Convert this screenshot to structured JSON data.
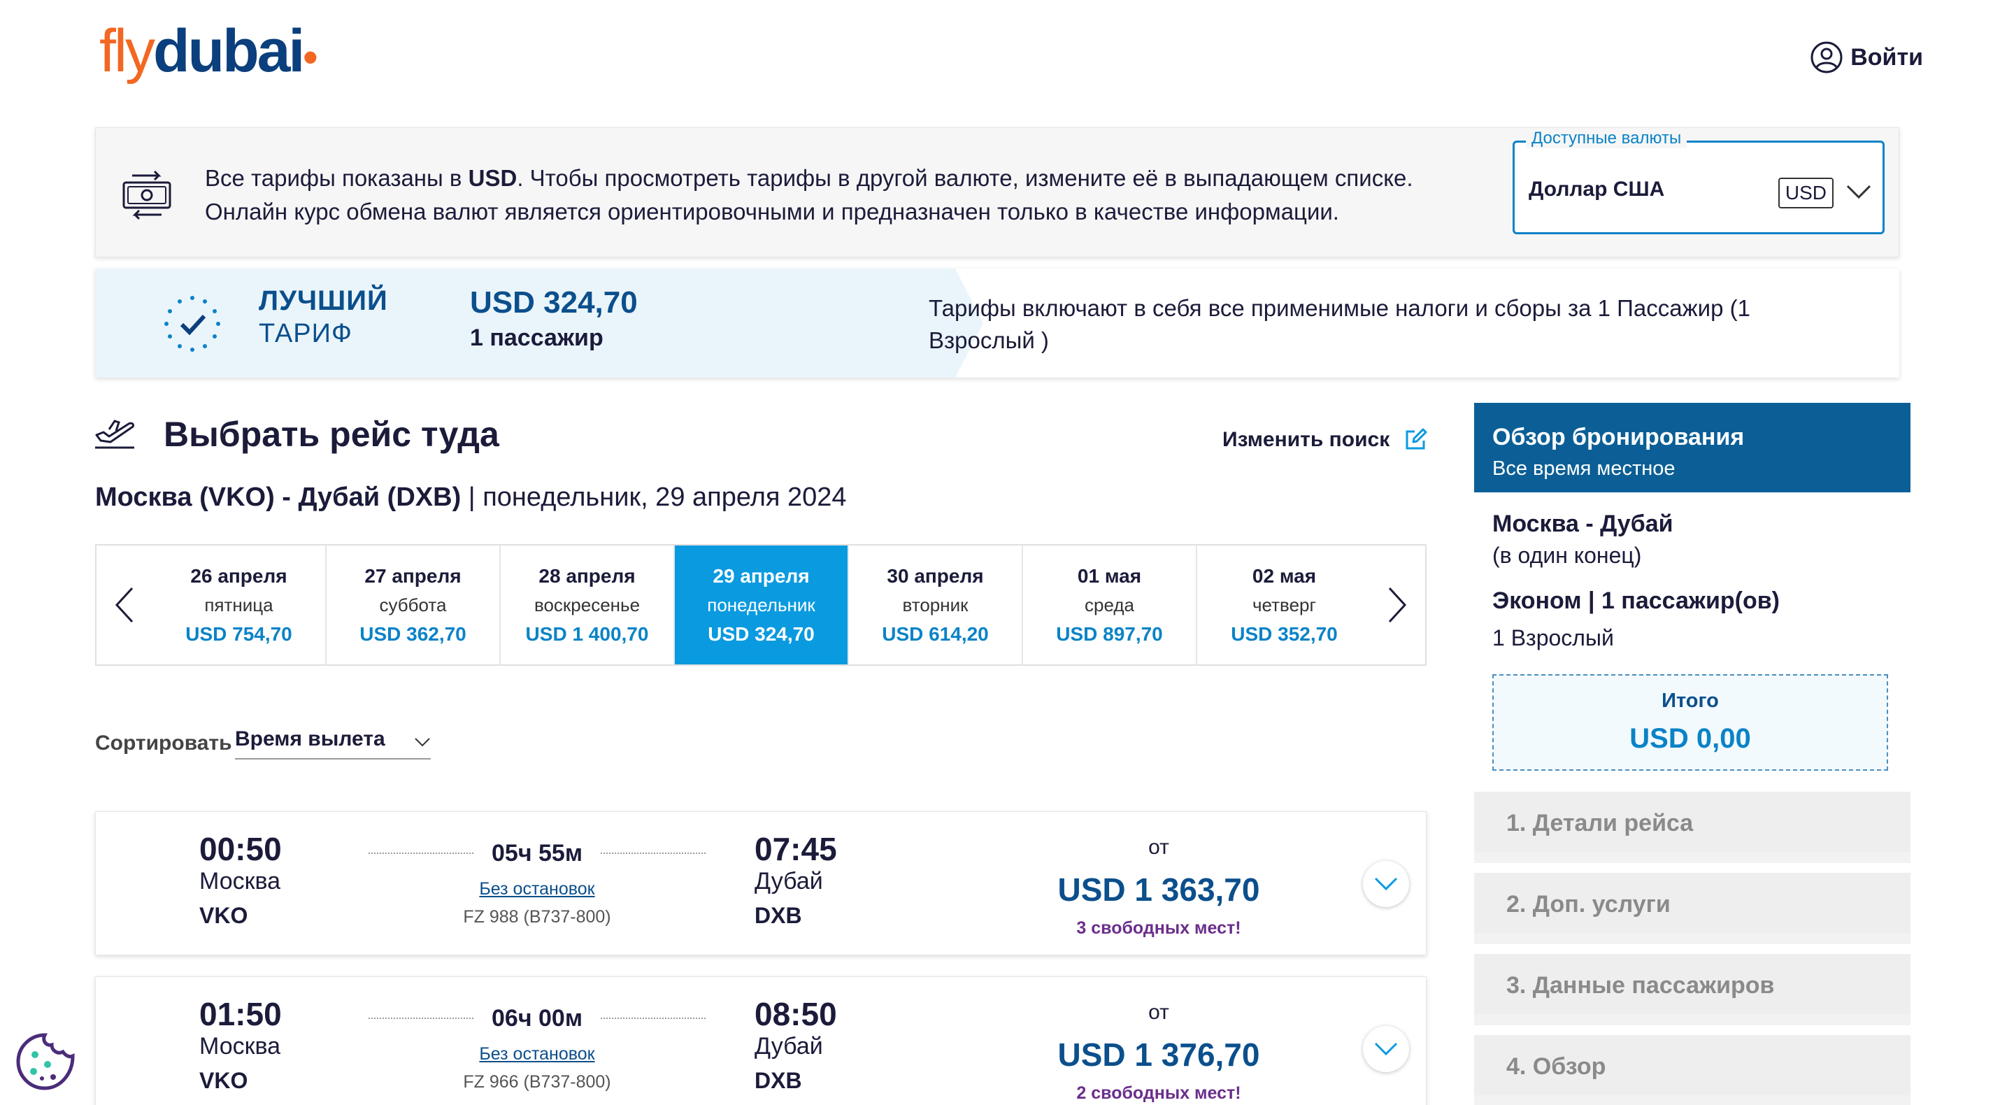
{
  "header": {
    "logo_fly": "fly",
    "logo_dubai": "dubai",
    "login_label": "Войти",
    "login_icon": "user-circle-icon"
  },
  "currency": {
    "notice_line1_prefix": "Все тарифы показаны в ",
    "notice_line1_code": "USD",
    "notice_line1_suffix": ". Чтобы просмотреть тарифы в другой валюте, измените её в выпадающем списке.",
    "notice_line2": "Онлайн курс обмена валют является ориентировочными и предназначен только в качестве информации.",
    "select_legend": "Доступные валюты",
    "select_value": "Доллар США",
    "select_code": "USD",
    "icon": "money-exchange-icon"
  },
  "best_fare": {
    "label_line1": "ЛУЧШИЙ",
    "label_line2": "ТАРИФ",
    "price": "USD 324,70",
    "passengers": "1 пассажир",
    "note": "Тарифы включают в себя все применимые налоги и сборы за 1 Пассажир (1 Взрослый )"
  },
  "search": {
    "title": "Выбрать рейс туда",
    "modify_label": "Изменить поиск",
    "route_bold": "Москва (VKO) - Дубай (DXB)",
    "route_date": " | понедельник, 29 апреля 2024"
  },
  "dates": [
    {
      "date": "26 апреля",
      "weekday": "пятница",
      "price": "USD 754,70",
      "active": false
    },
    {
      "date": "27 апреля",
      "weekday": "суббота",
      "price": "USD 362,70",
      "active": false
    },
    {
      "date": "28 апреля",
      "weekday": "воскресенье",
      "price": "USD 1 400,70",
      "active": false
    },
    {
      "date": "29 апреля",
      "weekday": "понедельник",
      "price": "USD 324,70",
      "active": true
    },
    {
      "date": "30 апреля",
      "weekday": "вторник",
      "price": "USD 614,20",
      "active": false
    },
    {
      "date": "01 мая",
      "weekday": "среда",
      "price": "USD 897,70",
      "active": false
    },
    {
      "date": "02 мая",
      "weekday": "четверг",
      "price": "USD 352,70",
      "active": false
    }
  ],
  "sort": {
    "label": "Сортировать",
    "value": "Время вылета"
  },
  "flights": [
    {
      "dep_time": "00:50",
      "dep_city": "Москва",
      "dep_code": "VKO",
      "duration": "05ч 55м",
      "stops": "Без остановок",
      "flight_number": "FZ 988 (B737-800)",
      "arr_time": "07:45",
      "arr_city": "Дубай",
      "arr_code": "DXB",
      "from_label": "от",
      "price": "USD 1 363,70",
      "seats": "3 свободных мест!"
    },
    {
      "dep_time": "01:50",
      "dep_city": "Москва",
      "dep_code": "VKO",
      "duration": "06ч 00м",
      "stops": "Без остановок",
      "flight_number": "FZ 966 (B737-800)",
      "arr_time": "08:50",
      "arr_city": "Дубай",
      "arr_code": "DXB",
      "from_label": "от",
      "price": "USD 1 376,70",
      "seats": "2 свободных мест!"
    }
  ],
  "summary": {
    "title": "Обзор бронирования",
    "subtitle": "Все время местное",
    "route": "Москва - Дубай",
    "trip_type": "(в один конец)",
    "cabin": "Эконом | 1 пассажир(ов)",
    "passengers": "1 Взрослый",
    "total_label": "Итого",
    "total_value": "USD 0,00",
    "steps": [
      "1. Детали рейса",
      "2. Доп. услуги",
      "3. Данные пассажиров",
      "4. Обзор"
    ]
  },
  "colors": {
    "brand_orange": "#f26722",
    "brand_navy": "#0b3f7d",
    "accent_blue": "#0a83c7",
    "active_date": "#0a9ae0",
    "summary_header": "#0b5f96",
    "seats_purple": "#6b2e8c"
  }
}
